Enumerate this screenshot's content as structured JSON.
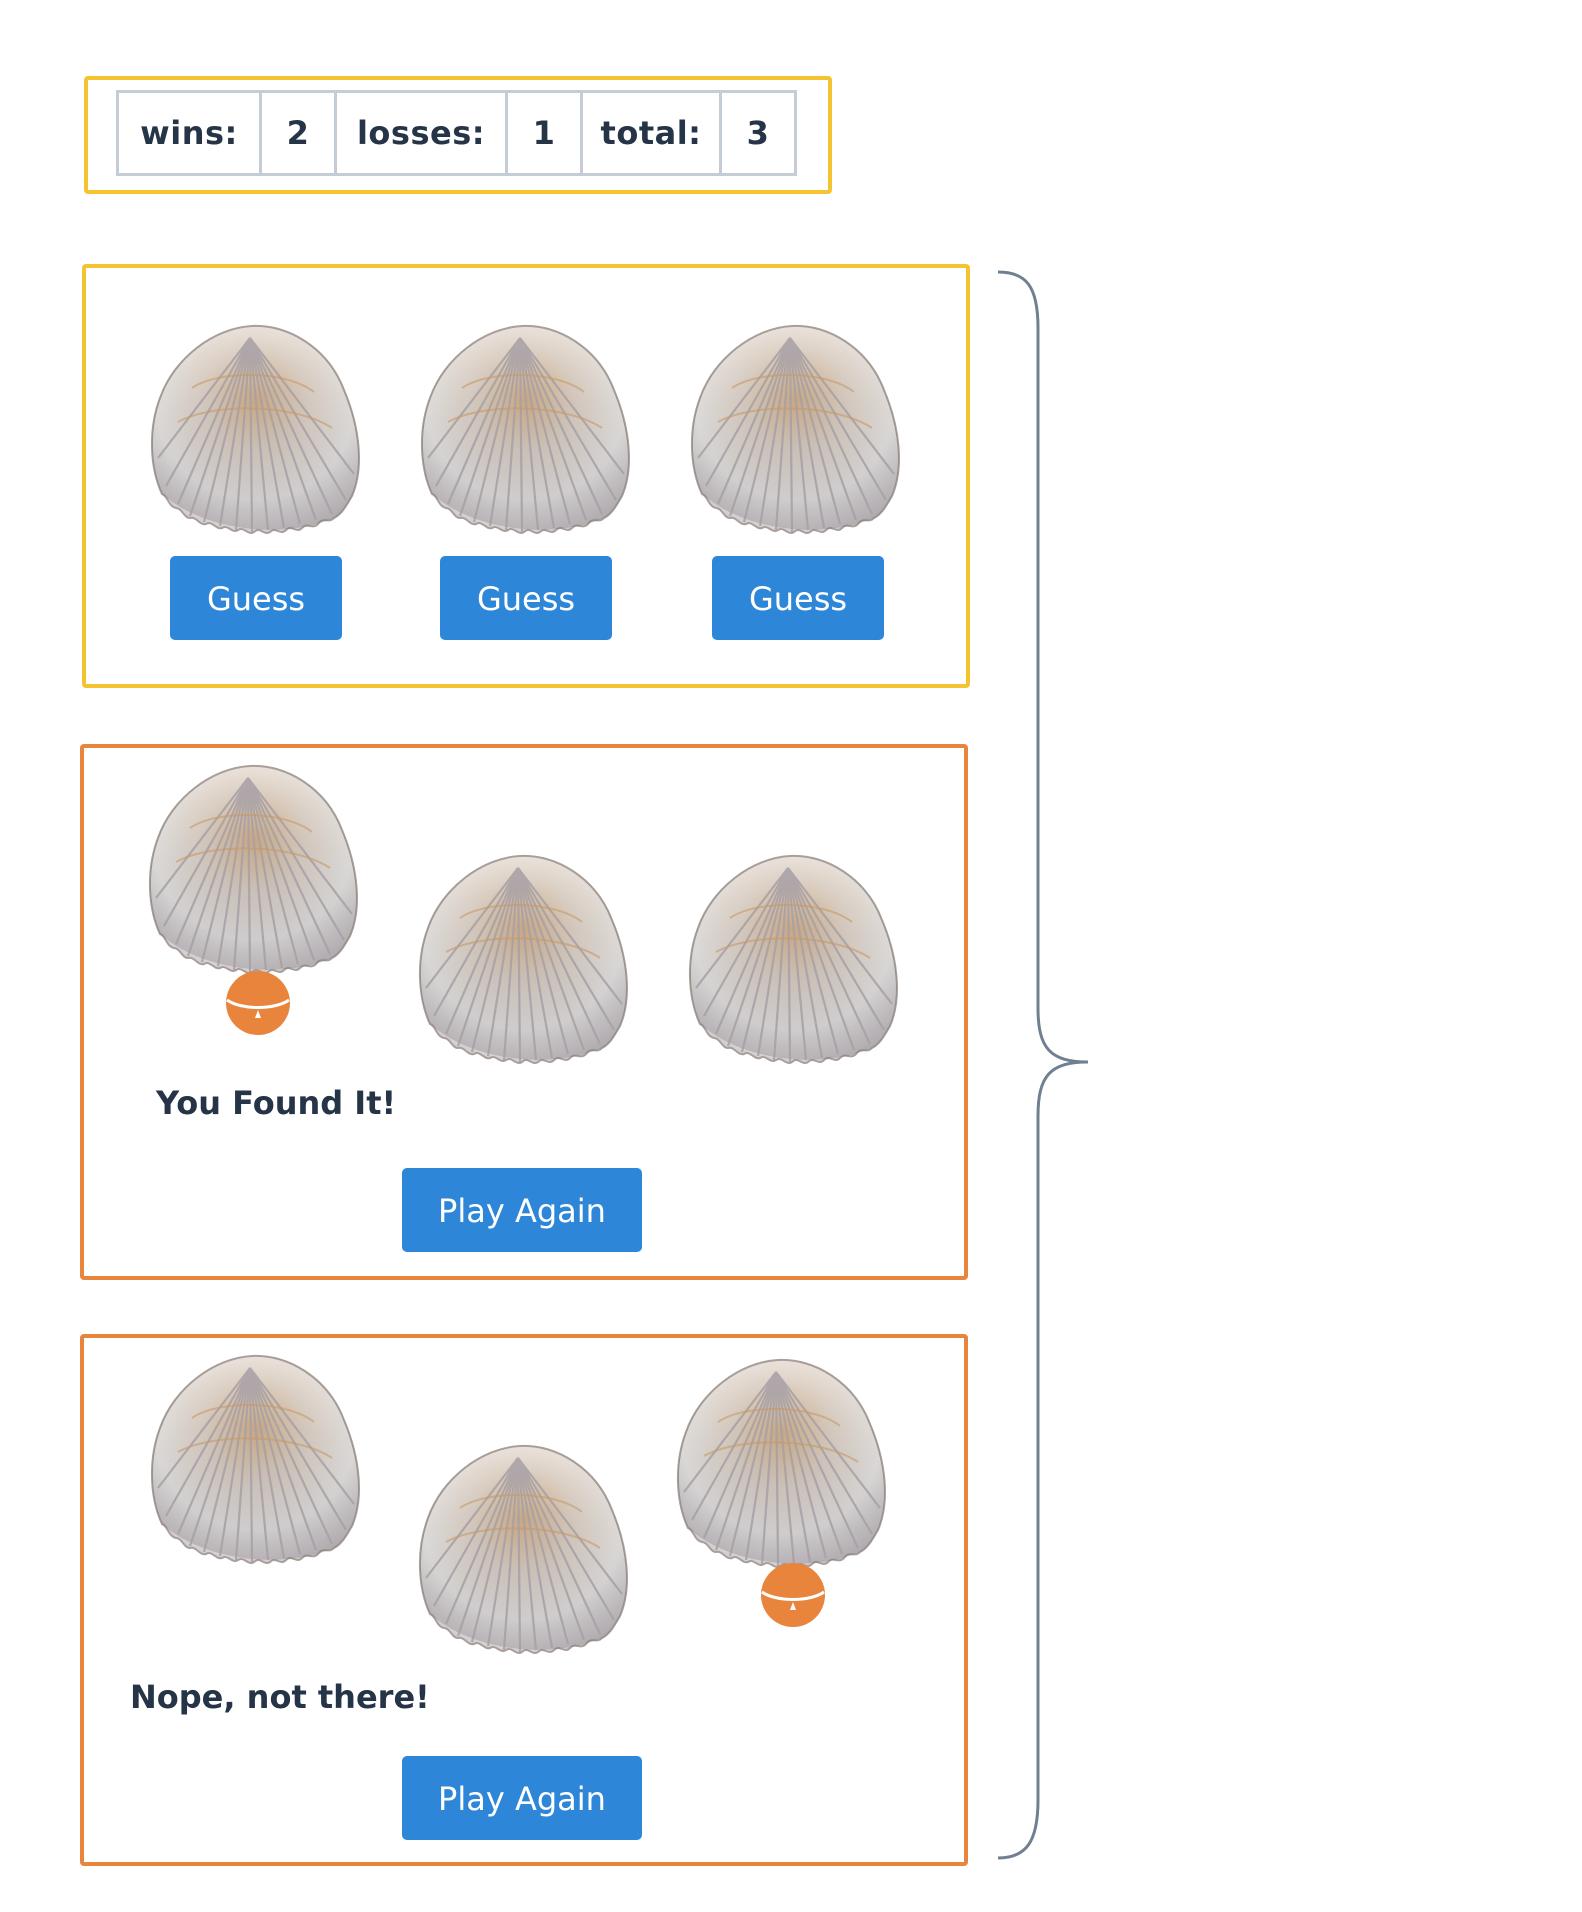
{
  "scoreboard": {
    "wins_label": "wins:",
    "wins_value": "2",
    "losses_label": "losses:",
    "losses_value": "1",
    "total_label": "total:",
    "total_value": "3"
  },
  "guess_panel": {
    "buttons": [
      {
        "label": "Guess"
      },
      {
        "label": "Guess"
      },
      {
        "label": "Guess"
      }
    ]
  },
  "win_panel": {
    "message": "You Found It!",
    "play_again_label": "Play Again"
  },
  "loss_panel": {
    "message": "Nope, not there!",
    "play_again_label": "Play Again"
  },
  "colors": {
    "accent_blue": "#2e86d9",
    "yellow_border": "#f4c430",
    "orange_border": "#e8843c",
    "pearl": "#e8843c",
    "text": "#253446",
    "brace": "#708090"
  },
  "icons": {
    "shell": "seashell-icon",
    "pearl": "pearl-icon"
  }
}
